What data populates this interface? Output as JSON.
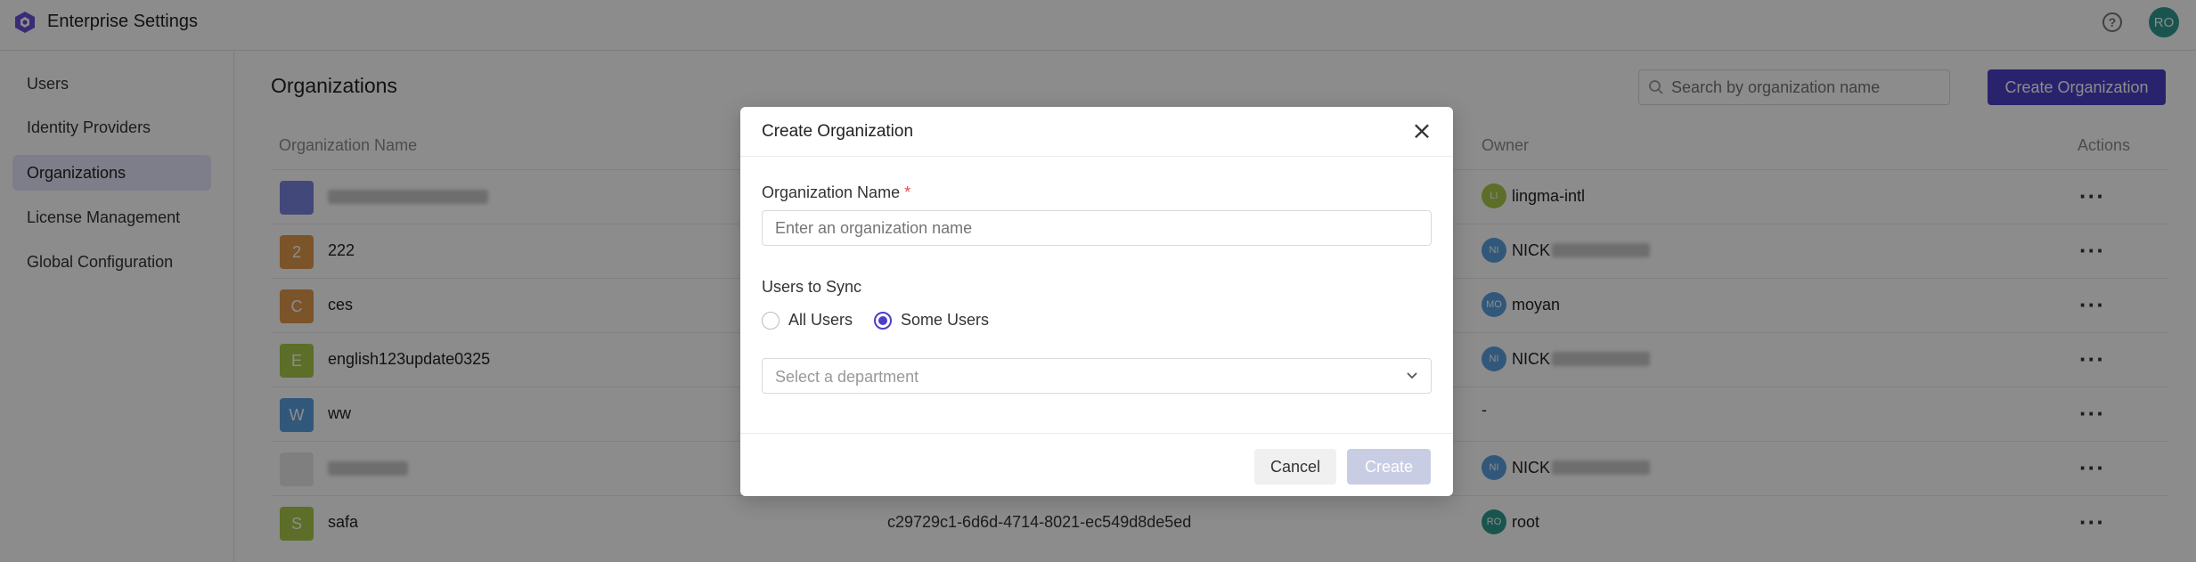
{
  "app": {
    "title": "Enterprise Settings",
    "user_initials": "RO",
    "help_icon": "question-circle-icon"
  },
  "sidebar": {
    "items": [
      {
        "label": "Users",
        "active": false
      },
      {
        "label": "Identity Providers",
        "active": false
      },
      {
        "label": "Organizations",
        "active": true
      },
      {
        "label": "License Management",
        "active": false
      },
      {
        "label": "Global Configuration",
        "active": false
      }
    ]
  },
  "main": {
    "title": "Organizations",
    "search_placeholder": "Search by organization name",
    "create_button": "Create Organization",
    "columns": {
      "name": "Organization Name",
      "owner": "Owner",
      "actions": "Actions"
    },
    "rows": [
      {
        "avatar": "",
        "avatar_color": "#7b83de",
        "name": "",
        "id": "",
        "owner_initials": "LI",
        "owner_color": "#a8c84a",
        "owner": "lingma-intl"
      },
      {
        "avatar": "2",
        "avatar_color": "#e0994c",
        "name": "222",
        "id": "",
        "owner_initials": "NI",
        "owner_color": "#5aa0de",
        "owner": "NICK"
      },
      {
        "avatar": "C",
        "avatar_color": "#e0994c",
        "name": "ces",
        "id": "",
        "owner_initials": "MO",
        "owner_color": "#5aa0de",
        "owner": "moyan"
      },
      {
        "avatar": "E",
        "avatar_color": "#a8c84a",
        "name": "english123update0325",
        "id": "",
        "owner_initials": "NI",
        "owner_color": "#5aa0de",
        "owner": "NICK"
      },
      {
        "avatar": "W",
        "avatar_color": "#5aa0de",
        "name": "ww",
        "id": "",
        "owner_initials": "",
        "owner_color": "",
        "owner": "-"
      },
      {
        "avatar": "",
        "avatar_color": "#e8e8e8",
        "name": "",
        "id": "",
        "owner_initials": "NI",
        "owner_color": "#5aa0de",
        "owner": "NICK"
      },
      {
        "avatar": "S",
        "avatar_color": "#a8c84a",
        "name": "safa",
        "id": "c29729c1-6d6d-4714-8021-ec549d8de5ed",
        "owner_initials": "RO",
        "owner_color": "#2e9b8e",
        "owner": "root"
      }
    ],
    "actions_glyph": "···"
  },
  "modal": {
    "title": "Create Organization",
    "name_label": "Organization Name",
    "required_mark": "*",
    "name_placeholder": "Enter an organization name",
    "sync_label": "Users to Sync",
    "radio_all": "All Users",
    "radio_some": "Some Users",
    "selected_radio": "Some Users",
    "department_placeholder": "Select a department",
    "cancel": "Cancel",
    "create": "Create"
  },
  "colors": {
    "accent": "#4b3fc7",
    "overlay": "rgba(0,0,0,0.45)",
    "disabled_button": "#c9cde3"
  }
}
